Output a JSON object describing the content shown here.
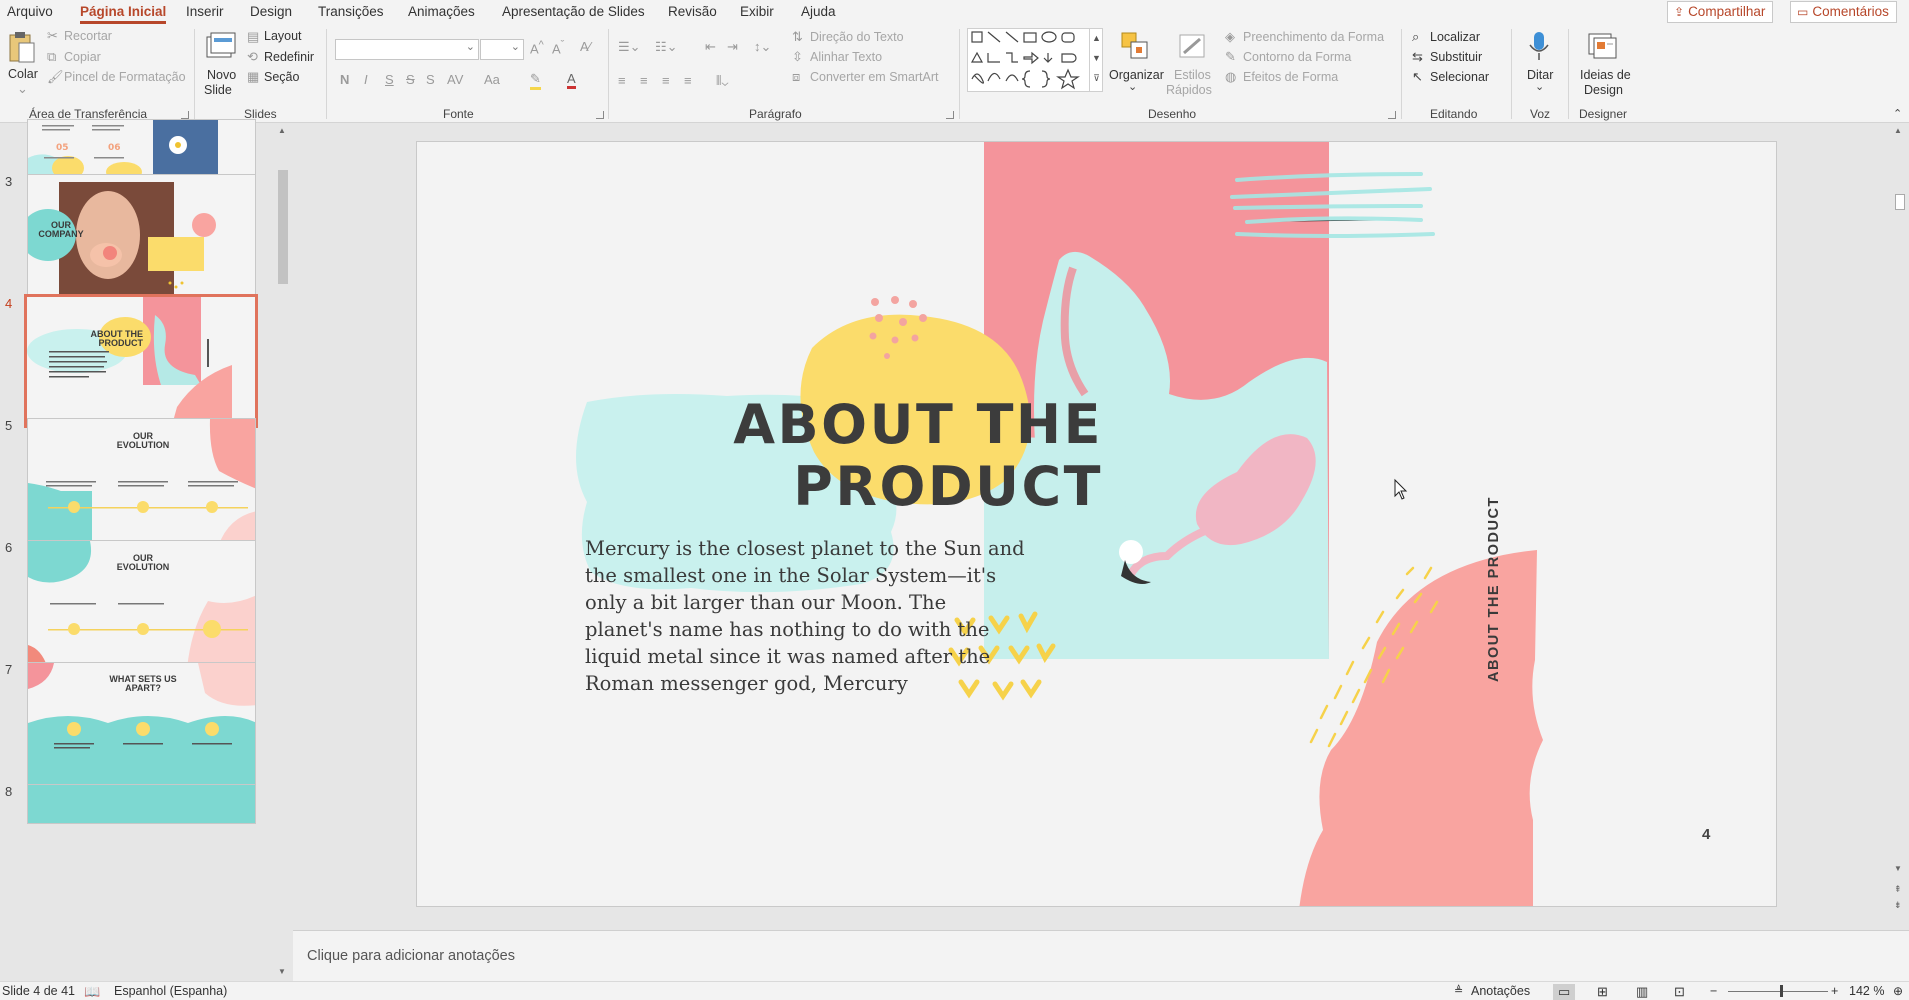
{
  "menu": {
    "tabs": [
      "Arquivo",
      "Página Inicial",
      "Inserir",
      "Design",
      "Transições",
      "Animações",
      "Apresentação de Slides",
      "Revisão",
      "Exibir",
      "Ajuda"
    ],
    "active_tab": "Página Inicial",
    "share_label": "Compartilhar",
    "comments_label": "Comentários"
  },
  "ribbon": {
    "clipboard": {
      "paste": "Colar",
      "cut": "Recortar",
      "copy": "Copiar",
      "format_painter": "Pincel de Formatação",
      "group": "Área de Transferência"
    },
    "slides": {
      "new_slide_1": "Novo",
      "new_slide_2": "Slide",
      "layout": "Layout",
      "reset": "Redefinir",
      "section": "Seção",
      "group": "Slides"
    },
    "font": {
      "bold": "N",
      "italic": "I",
      "underline": "S",
      "strike": "S",
      "spacing": "AV",
      "case": "Aa",
      "group": "Fonte"
    },
    "paragraph": {
      "text_direction": "Direção do Texto",
      "align_text": "Alinhar Texto",
      "smartart": "Converter em SmartArt",
      "group": "Parágrafo"
    },
    "drawing": {
      "arrange": "Organizar",
      "quick_styles_1": "Estilos",
      "quick_styles_2": "Rápidos",
      "shape_fill": "Preenchimento da Forma",
      "shape_outline": "Contorno da Forma",
      "shape_effects": "Efeitos de Forma",
      "group": "Desenho"
    },
    "editing": {
      "find": "Localizar",
      "replace": "Substituir",
      "select": "Selecionar",
      "group": "Editando"
    },
    "voice": {
      "dictate": "Ditar",
      "group": "Voz"
    },
    "designer": {
      "ideas_1": "Ideias de",
      "ideas_2": "Design",
      "group": "Designer"
    }
  },
  "thumbnails": [
    {
      "number": "3",
      "title_1": "OUR",
      "title_2": "COMPANY"
    },
    {
      "number": "4",
      "title_1": "ABOUT THE",
      "title_2": "PRODUCT"
    },
    {
      "number": "5",
      "title_1": "OUR",
      "title_2": "EVOLUTION"
    },
    {
      "number": "6",
      "title_1": "OUR",
      "title_2": "EVOLUTION"
    },
    {
      "number": "7",
      "title_1": "WHAT SETS US",
      "title_2": "APART?"
    },
    {
      "number": "8"
    }
  ],
  "slide": {
    "title_line1": "ABOUT THE",
    "title_line2": "PRODUCT",
    "body": "Mercury is the closest planet to the Sun and the smallest one in the Solar System—it's only a bit larger than our Moon. The planet's name has nothing to do with the liquid metal since it was named after the Roman messenger god, Mercury",
    "vertical_title": "ABOUT THE PRODUCT",
    "page_number": "4"
  },
  "notes_placeholder": "Clique para adicionar anotações",
  "status": {
    "slide_count": "Slide 4 de 41",
    "language": "Espanhol (Espanha)",
    "notes": "Anotações",
    "zoom": "142 %"
  },
  "colors": {
    "accent": "#b7472a",
    "pink": "#f4949b",
    "coral": "#f9a4a0",
    "mint": "#b9ecea",
    "yellow": "#fbdc6b"
  }
}
